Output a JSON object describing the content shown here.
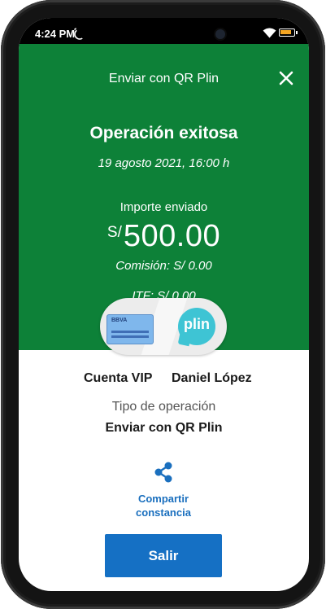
{
  "status_bar": {
    "time": "4:24 PM",
    "icons": [
      "alarm-icon",
      "wifi-icon",
      "battery-icon"
    ]
  },
  "header": {
    "title": "Enviar con QR Plin",
    "close_icon": "close-icon"
  },
  "result": {
    "title": "Operación exitosa",
    "date": "19 agosto 2021, 16:00 h",
    "amount_label": "Importe enviado",
    "currency": "S/",
    "amount": "500.00",
    "commission": "Comisión: S/ 0.00",
    "itf": "ITF: S/ 0.00"
  },
  "transfer": {
    "card_brand": "BBVA",
    "wallet_brand": "plin",
    "from": "Cuenta VIP",
    "to": "Daniel López"
  },
  "operation": {
    "type_label": "Tipo de operación",
    "type_value": "Enviar con QR Plin"
  },
  "share": {
    "icon": "share-icon",
    "line1": "Compartir",
    "line2": "constancia"
  },
  "exit_button": "Salir",
  "colors": {
    "header_green": "#0d8138",
    "accent_blue": "#1570c4",
    "link_blue": "#1a6fbe",
    "plin_cyan": "#3ec4d4"
  }
}
